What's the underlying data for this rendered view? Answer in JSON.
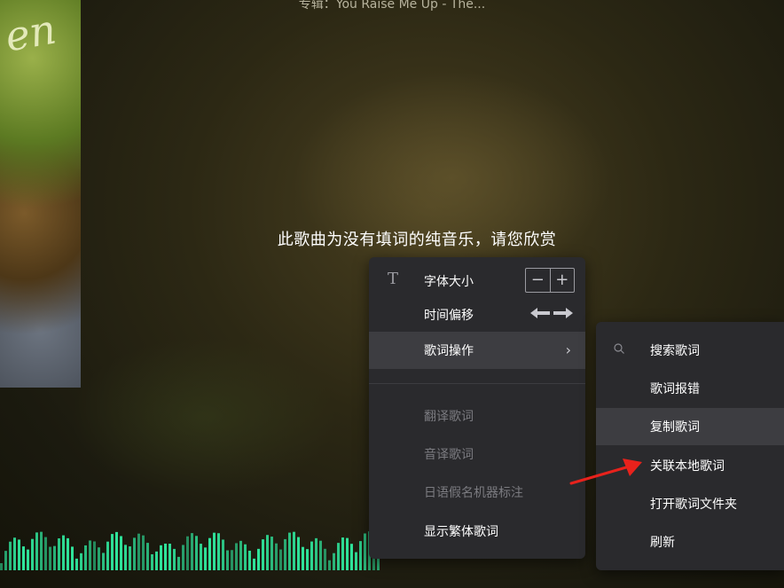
{
  "header": {
    "album_line": "专辑：You Raise Me Up - The..."
  },
  "cover": {
    "script_text": "en"
  },
  "lyrics": {
    "message": "此歌曲为没有填词的纯音乐，请您欣赏"
  },
  "main_menu": {
    "font_size": {
      "label": "字体大小",
      "minus": "−",
      "plus": "+"
    },
    "time_offset": {
      "label": "时间偏移"
    },
    "lyric_actions": {
      "label": "歌词操作",
      "chevron": "›"
    },
    "translate": {
      "label": "翻译歌词"
    },
    "transliterate": {
      "label": "音译歌词"
    },
    "kana": {
      "label": "日语假名机器标注"
    },
    "traditional": {
      "label": "显示繁体歌词"
    }
  },
  "sub_menu": {
    "items": [
      {
        "label": "搜索歌词",
        "icon": "search-icon"
      },
      {
        "label": "歌词报错"
      },
      {
        "label": "复制歌词"
      },
      {
        "label": "关联本地歌词"
      },
      {
        "label": "打开歌词文件夹"
      },
      {
        "label": "刷新"
      }
    ]
  },
  "colors": {
    "menu_bg": "#2a2a2d",
    "menu_highlight": "#3d3d41",
    "disabled_text": "#7b7b80",
    "waveform": "#2fe39a",
    "annotation_arrow": "#e8221c"
  }
}
